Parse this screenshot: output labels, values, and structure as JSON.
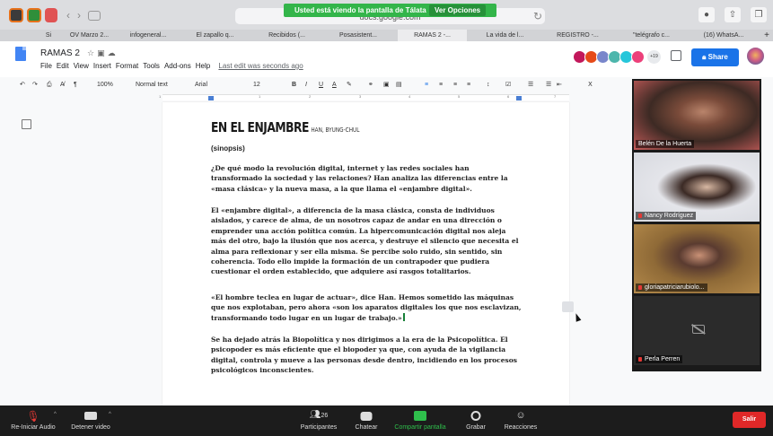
{
  "share_banner": {
    "message": "Usted está viendo la pantalla de Tálata",
    "options": "Ver Opciones"
  },
  "browser": {
    "url": "docs.google.com",
    "tabs": [
      "Si",
      "OV Marzo 2...",
      "infogeneral...",
      "El zapallo q...",
      "Recibidos (...",
      "Posasistent...",
      "RAMAS 2 -...",
      "La vida de l...",
      "REGISTRO -...",
      "\"telégrafo c...",
      "(16) WhatsA..."
    ],
    "active_tab": 6
  },
  "doc": {
    "title": "RAMAS 2",
    "menu": [
      "File",
      "Edit",
      "View",
      "Insert",
      "Format",
      "Tools",
      "Add-ons",
      "Help"
    ],
    "last_edit": "Last edit was seconds ago",
    "collaborator_count": "+19",
    "share_label": "Share",
    "toolbar": {
      "zoom": "100%",
      "style": "Normal text",
      "font": "Arial",
      "size": "12"
    },
    "ruler_numbers": [
      "1",
      "1",
      "2",
      "3",
      "4",
      "5",
      "6",
      "7"
    ],
    "heading": "EN EL ENJAMBRE",
    "author": "HAN, BYUNG-CHUL",
    "sinopsis": "(sinopsis)",
    "paragraphs": [
      [
        "¿De qué modo la revolución digital, internet y las redes sociales han",
        "transformado la sociedad y las relaciones? Han analiza las diferencias entre la",
        "«masa clásica» y la nueva masa, a la que llama el «enjambre digital»."
      ],
      [
        "El «enjambre digital», a diferencia de la masa clásica, consta de individuos",
        "aislados, y carece de alma, de un nosotros capaz de andar en una dirección o",
        "emprender una acción política común. La hipercomunicación digital nos aleja",
        "más del otro, bajo la ilusión que nos acerca, y destruye el silencio que necesita el",
        "alma para reflexionar y ser ella misma. Se percibe solo ruido, sin sentido, sin",
        "coherencia. Todo ello impide la formación de un contrapoder que pudiera",
        "cuestionar el orden establecido, que adquiere así rasgos totalitarios."
      ],
      [
        "«El hombre teclea en lugar de actuar», dice Han. Hemos sometido las máquinas",
        "que nos explotaban, pero ahora «son los aparatos digitales los que nos esclavizan,",
        "transformando todo lugar en un lugar de trabajo.»"
      ],
      [
        "Se ha dejado atrás la Biopolítica y nos dirigimos a la era de la Psicopolítica. El",
        "psicopoder es más eficiente que el biopoder ya que, con ayuda de la vigilancia",
        "digital, controla y mueve a las personas desde dentro, incidiendo en los procesos",
        "psicológicos inconscientes."
      ]
    ]
  },
  "participants": [
    {
      "name": "Belén De la Huerta"
    },
    {
      "name": "Nancy Rodríguez"
    },
    {
      "name": "gloriapatriciarubiolo..."
    },
    {
      "name": "Perla Perren"
    }
  ],
  "zoom_bar": {
    "audio": "Re-Iniciar Audio",
    "video": "Detener video",
    "participants_label": "Participantes",
    "participants_count": "26",
    "chat": "Chatear",
    "share_screen": "Compartir pantalla",
    "record": "Grabar",
    "reactions": "Reacciones",
    "leave": "Salir"
  },
  "colors": {
    "share_green": "#33b54a",
    "docs_blue": "#1a73e8",
    "leave_red": "#e02828"
  }
}
